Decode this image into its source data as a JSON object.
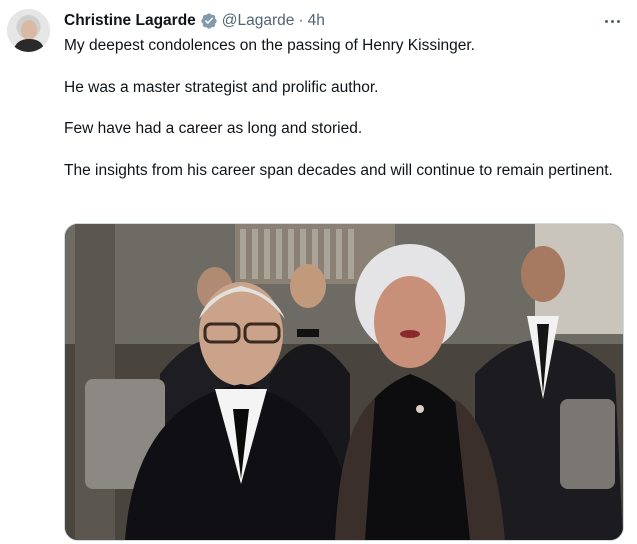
{
  "tweet": {
    "author_name": "Christine Lagarde",
    "handle": "@Lagarde",
    "separator": "·",
    "time": "4h",
    "paragraphs": [
      "My deepest condolences on the passing of Henry Kissinger.",
      "He was a master strategist and prolific author.",
      "Few have had a career as long and storied.",
      "The insights from his career span decades and will continue to remain pertinent."
    ]
  },
  "icons": {
    "verified": "verified-badge-icon",
    "more": "more-options-icon"
  },
  "colors": {
    "text": "#0f1419",
    "secondary": "#536471",
    "verified": "#829aab",
    "border": "#cfd9de"
  }
}
